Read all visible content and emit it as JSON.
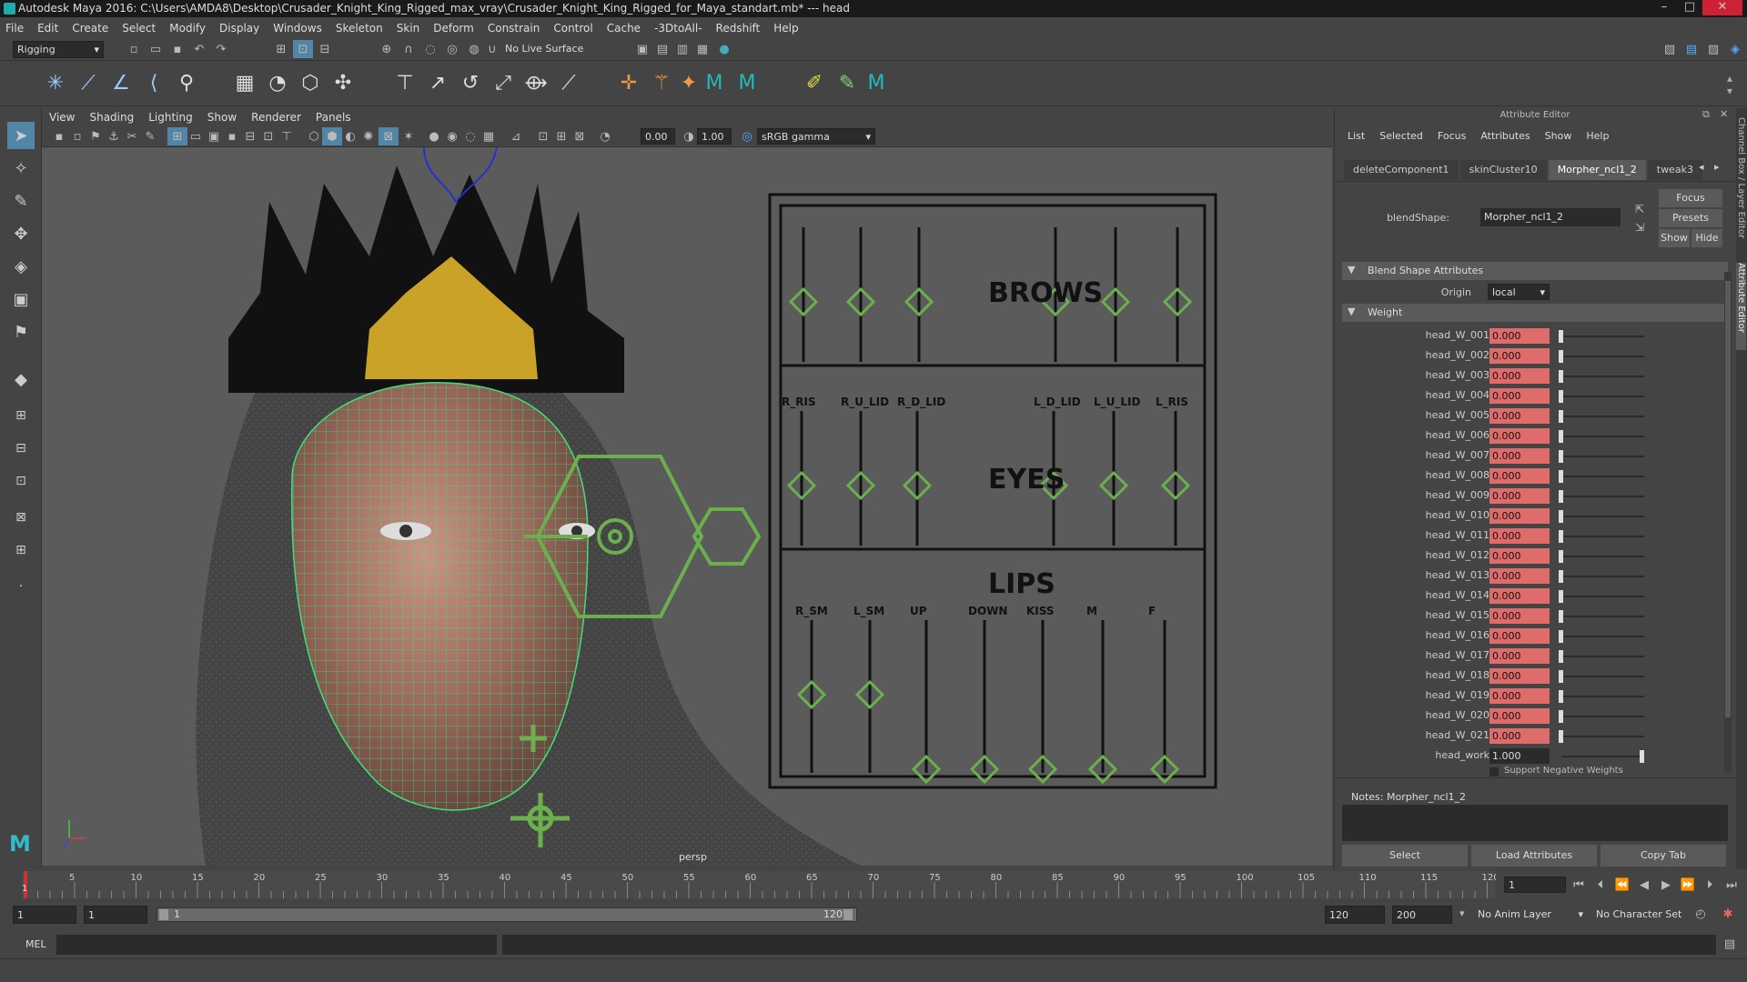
{
  "window": {
    "title": "Autodesk Maya 2016: C:\\Users\\AMDA8\\Desktop\\Crusader_Knight_King_Rigged_max_vray\\Crusader_Knight_King_Rigged_for_Maya_standart.mb*   ---   head"
  },
  "menubar": {
    "items": [
      "File",
      "Edit",
      "Create",
      "Select",
      "Modify",
      "Display",
      "Windows",
      "Skeleton",
      "Skin",
      "Deform",
      "Constrain",
      "Control",
      "Cache",
      "-3DtoAll-",
      "Redshift",
      "Help"
    ]
  },
  "statusline": {
    "mode": "Rigging",
    "live_surface": "No Live Surface"
  },
  "viewport": {
    "menu": [
      "View",
      "Shading",
      "Lighting",
      "Show",
      "Renderer",
      "Panels"
    ],
    "exposure": "0.00",
    "gamma": "1.00",
    "colorspace": "sRGB gamma",
    "camera_label": "persp",
    "rig_labels": {
      "brows": "BROWS",
      "eyes": "EYES",
      "lips": "LIPS",
      "eye_ctrls": [
        "R_RIS",
        "R_U_LID",
        "R_D_LID",
        "L_D_LID",
        "L_U_LID",
        "L_RIS"
      ],
      "lip_ctrls": [
        "R_SM",
        "L_SM",
        "UP",
        "DOWN",
        "KISS",
        "M",
        "F"
      ]
    }
  },
  "attribute_editor": {
    "panel_title": "Attribute Editor",
    "menu": [
      "List",
      "Selected",
      "Focus",
      "Attributes",
      "Show",
      "Help"
    ],
    "tabs": [
      "deleteComponent1",
      "skinCluster10",
      "Morpher_ncl1_2",
      "tweak3"
    ],
    "active_tab": "Morpher_ncl1_2",
    "node_type_label": "blendShape:",
    "node_name": "Morpher_ncl1_2",
    "buttons": {
      "focus": "Focus",
      "presets": "Presets",
      "show": "Show",
      "hide": "Hide"
    },
    "section_blend": "Blend Shape Attributes",
    "origin_label": "Origin",
    "origin_value": "local",
    "section_weight": "Weight",
    "weights": [
      {
        "name": "head_W_001",
        "value": "0.000"
      },
      {
        "name": "head_W_002",
        "value": "0.000"
      },
      {
        "name": "head_W_003",
        "value": "0.000"
      },
      {
        "name": "head_W_004",
        "value": "0.000"
      },
      {
        "name": "head_W_005",
        "value": "0.000"
      },
      {
        "name": "head_W_006",
        "value": "0.000"
      },
      {
        "name": "head_W_007",
        "value": "0.000"
      },
      {
        "name": "head_W_008",
        "value": "0.000"
      },
      {
        "name": "head_W_009",
        "value": "0.000"
      },
      {
        "name": "head_W_010",
        "value": "0.000"
      },
      {
        "name": "head_W_011",
        "value": "0.000"
      },
      {
        "name": "head_W_012",
        "value": "0.000"
      },
      {
        "name": "head_W_013",
        "value": "0.000"
      },
      {
        "name": "head_W_014",
        "value": "0.000"
      },
      {
        "name": "head_W_015",
        "value": "0.000"
      },
      {
        "name": "head_W_016",
        "value": "0.000"
      },
      {
        "name": "head_W_017",
        "value": "0.000"
      },
      {
        "name": "head_W_018",
        "value": "0.000"
      },
      {
        "name": "head_W_019",
        "value": "0.000"
      },
      {
        "name": "head_W_020",
        "value": "0.000"
      },
      {
        "name": "head_W_021",
        "value": "0.000"
      }
    ],
    "head_work": {
      "name": "head_work",
      "value": "1.000"
    },
    "support_negative": "Support Negative Weights",
    "notes_label": "Notes:  Morpher_ncl1_2",
    "bottom_buttons": {
      "select": "Select",
      "load": "Load Attributes",
      "copy": "Copy Tab"
    },
    "side_tabs": {
      "channel_box": "Channel Box / Layer Editor",
      "attribute_editor": "Attribute Editor"
    }
  },
  "timeline": {
    "ticks": [
      "5",
      "10",
      "15",
      "20",
      "25",
      "30",
      "35",
      "40",
      "45",
      "50",
      "55",
      "60",
      "65",
      "70",
      "75",
      "80",
      "85",
      "90",
      "95",
      "100",
      "105",
      "110",
      "115",
      "120"
    ],
    "start_tick": "1",
    "current_frame": "1"
  },
  "range": {
    "start": "1",
    "playback_start": "1",
    "range_start_label": "1",
    "range_end_label": "120",
    "playback_end": "120",
    "end": "200",
    "anim_layer": "No Anim Layer",
    "character_set": "No Character Set"
  },
  "cmdline": {
    "lang": "MEL"
  }
}
